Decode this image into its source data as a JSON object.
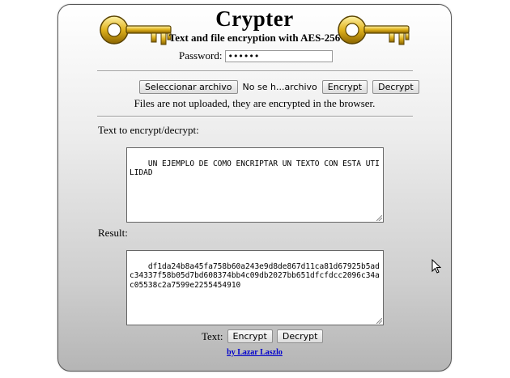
{
  "app": {
    "title": "Crypter",
    "subtitle": "Text and file encryption with AES-256"
  },
  "password": {
    "label": "Password:",
    "value": "••••••"
  },
  "file": {
    "select_label": "Seleccionar archivo",
    "status": "No se h...archivo",
    "encrypt_label": "Encrypt",
    "decrypt_label": "Decrypt",
    "note": "Files are not uploaded, they are encrypted in the browser."
  },
  "input": {
    "label": "Text to encrypt/decrypt:",
    "value": "UN EJEMPLO DE COMO ENCRIPTAR UN TEXTO CON ESTA UTILIDAD"
  },
  "result": {
    "label": "Result:",
    "value": "df1da24b8a45fa758b60a243e9d8de867d11ca81d67925b5adc34337f58b05d7bd608374bb4c09db2027bb651dfcfdcc2096c34ac05538c2a7599e2255454910"
  },
  "text_actions": {
    "label": "Text:",
    "encrypt_label": "Encrypt",
    "decrypt_label": "Decrypt"
  },
  "footer": {
    "author": "by Lazar Laszlo"
  },
  "colors": {
    "key_gold": "#e0b21c",
    "key_outline": "#5a4300",
    "link": "#0000cc"
  }
}
